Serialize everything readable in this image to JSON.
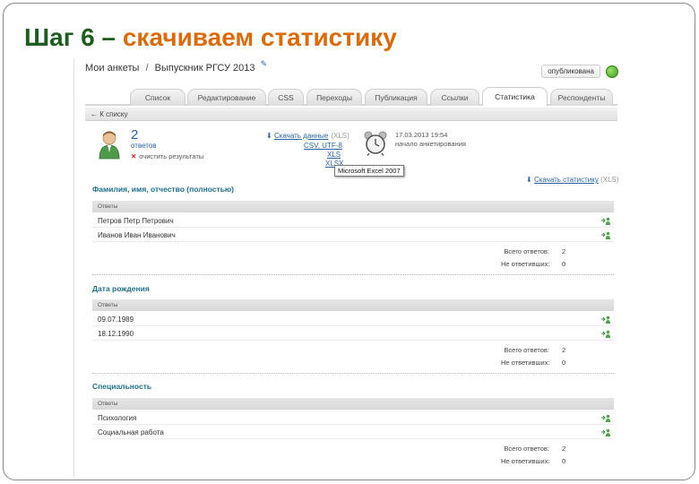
{
  "slide": {
    "title_prefix": "Шаг 6 – ",
    "title_accent": "скачиваем статистику",
    "colors": {
      "title": "#1f5c1f",
      "accent": "#d96b0b",
      "link": "#2a64a8",
      "section": "#1e6f8e"
    }
  },
  "header": {
    "breadcrumb_root": "Мои анкеты",
    "breadcrumb_sep": "/",
    "breadcrumb_current": "Выпускник РГСУ 2013",
    "edit_icon": "pencil-icon",
    "published_label": "опубликована"
  },
  "tabs": [
    "Список",
    "Редактирование",
    "CSS",
    "Переходы",
    "Публикация",
    "Ссылки",
    "Статистика",
    "Респонденты"
  ],
  "active_tab": "Статистика",
  "subnav": {
    "back_label": "← К списку"
  },
  "summary": {
    "count": "2",
    "count_label": "ответов",
    "clear_label": "очистить результаты",
    "download_label": "Скачать данные",
    "download_hint": "(XLS)",
    "options": [
      "CSV, UTF-8",
      "XLS",
      "XLSX"
    ],
    "tooltip": "Microsoft Excel 2007",
    "date": "17.03.2013 19:54",
    "date_label": "начало анкетирования",
    "download_stats_label": "Скачать статистику",
    "download_stats_hint": "(XLS)"
  },
  "sections": [
    {
      "title": "Фамилия, имя, отчество (полностью)",
      "header": "Ответы",
      "answers": [
        "Петров Петр Петрович",
        "Иванов Иван Иванович"
      ],
      "total_label": "Всего ответов:",
      "total": "2",
      "skipped_label": "Не ответивших:",
      "skipped": "0"
    },
    {
      "title": "Дата рождения",
      "header": "Ответы",
      "answers": [
        "09.07.1989",
        "18.12.1990"
      ],
      "total_label": "Всего ответов:",
      "total": "2",
      "skipped_label": "Не ответивших:",
      "skipped": "0"
    },
    {
      "title": "Специальность",
      "header": "Ответы",
      "answers": [
        "Психология",
        "Социальная работа"
      ],
      "total_label": "Всего ответов:",
      "total": "2",
      "skipped_label": "Не ответивших:",
      "skipped": "0"
    }
  ]
}
